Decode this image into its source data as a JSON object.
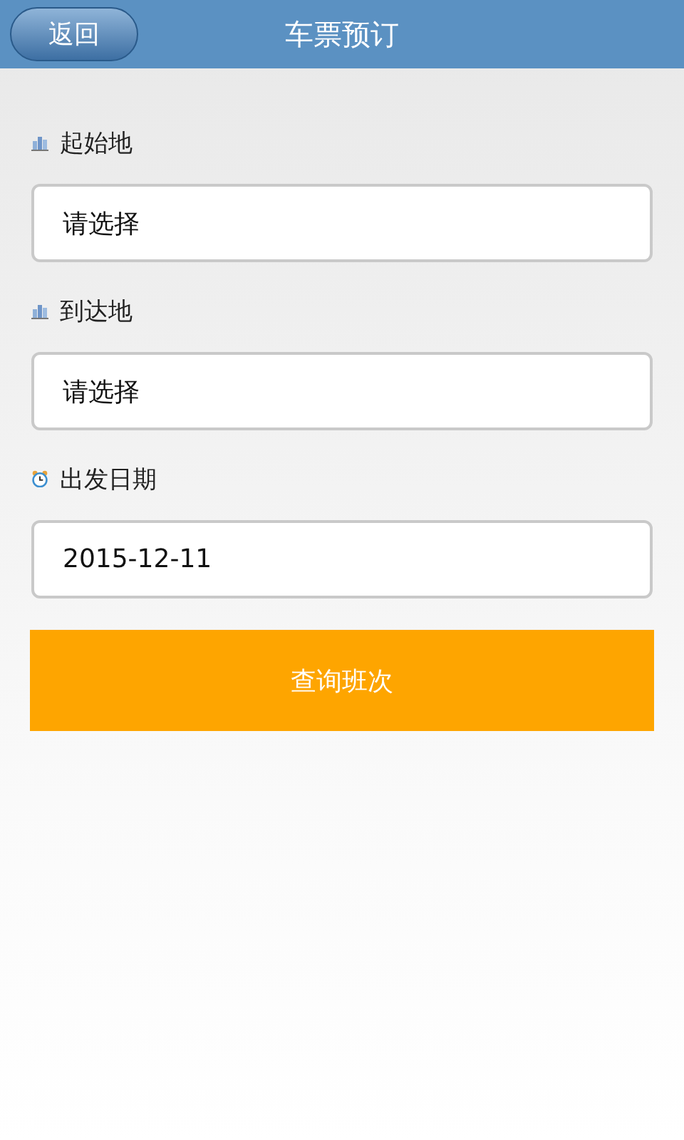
{
  "header": {
    "back_button": "返回",
    "title": "车票预订"
  },
  "fields": [
    {
      "label": "起始地",
      "kind": "place",
      "value": "请选择"
    },
    {
      "label": "到达地",
      "kind": "place",
      "value": "请选择"
    },
    {
      "label": "出发日期",
      "kind": "date",
      "value": "2015-12-11"
    }
  ],
  "search_button": "查询班次"
}
